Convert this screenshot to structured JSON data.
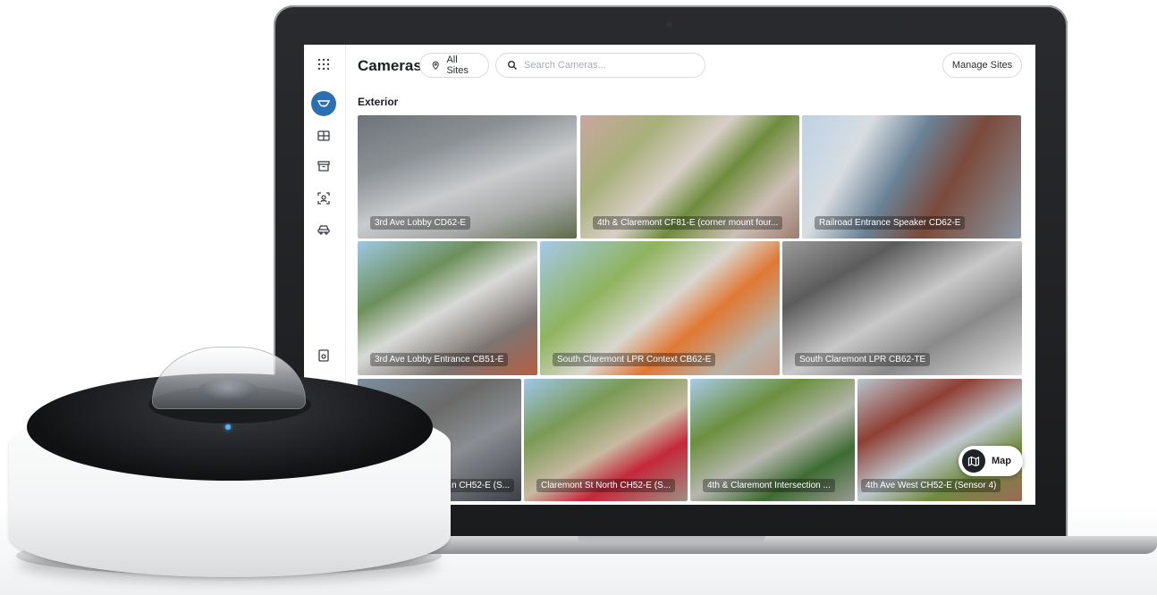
{
  "header": {
    "title": "Cameras",
    "all_sites": "All Sites",
    "search_placeholder": "Search Cameras...",
    "manage_sites": "Manage Sites"
  },
  "section": {
    "label": "Exterior"
  },
  "cameras": [
    {
      "label": "3rd Ave Lobby CD62-E"
    },
    {
      "label": "4th & Claremont CF81-E (corner mount four..."
    },
    {
      "label": "Railroad Entrance Speaker CD62-E"
    },
    {
      "label": "3rd Ave Lobby Entrance CB51-E"
    },
    {
      "label": "South Claremont LPR Context CB62-E"
    },
    {
      "label": "South Claremont LPR CB62-TE"
    },
    {
      "label": "...n CH52-E (S..."
    },
    {
      "label": "Claremont St North CH52-E (S..."
    },
    {
      "label": "4th & Claremont Intersection ..."
    },
    {
      "label": "4th Ave West CH52-E (Sensor 4)"
    }
  ],
  "map_button": {
    "label": "Map"
  },
  "sidebar": {
    "icons": [
      "apps-grid-icon",
      "camera-icon",
      "layout-grid-icon",
      "archive-icon",
      "face-scan-icon",
      "vehicle-icon",
      "report-icon",
      "bell-icon"
    ]
  },
  "colors": {
    "accent": "#2b6fb3",
    "text": "#1c1f24",
    "border": "#d7dadf"
  }
}
